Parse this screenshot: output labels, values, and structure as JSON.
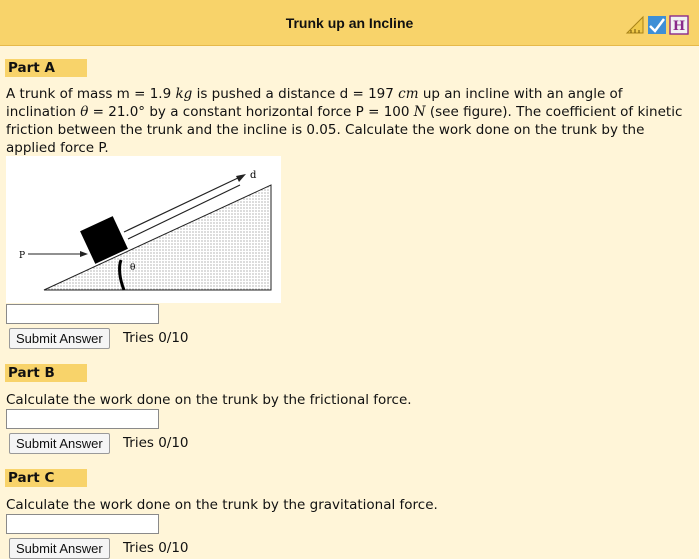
{
  "header": {
    "title": "Trunk up an Incline"
  },
  "icons": [
    "ruler-triangle-icon",
    "checkmark-graph-icon",
    "hint-icon"
  ],
  "hint_icon_text": "H",
  "partA": {
    "label": "Part A",
    "text1": "A trunk of mass m = 1.9 ",
    "unit_mass": "kg",
    "text2": " is pushed a distance d = 197 ",
    "unit_dist": "cm",
    "text3": " up an incline with an angle of inclination ",
    "theta": "θ",
    "text4": " = 21.0° by a constant horizontal force P = 100 ",
    "unit_force": "N",
    "text5": " (see figure). The coefficient of kinetic friction between the trunk and the incline is 0.05. Calculate the work done on the trunk by the applied force P.",
    "figure": {
      "label_p": "P",
      "label_d": "d",
      "label_theta": "θ"
    },
    "answer": "",
    "submit": "Submit Answer",
    "tries": "Tries 0/10"
  },
  "partB": {
    "label": "Part B",
    "text": "Calculate the work done on the trunk by the frictional force.",
    "answer": "",
    "submit": "Submit Answer",
    "tries": "Tries 0/10"
  },
  "partC": {
    "label": "Part C",
    "text": "Calculate the work done on the trunk by the gravitational force.",
    "answer": "",
    "submit": "Submit Answer",
    "tries": "Tries 0/10"
  }
}
